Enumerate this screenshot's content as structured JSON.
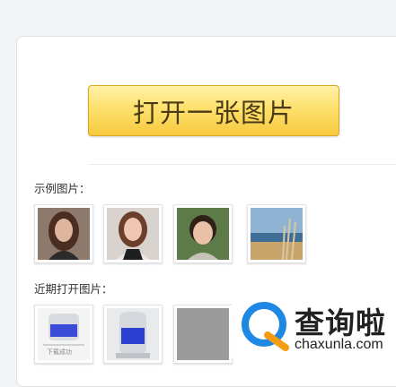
{
  "open_button": {
    "label": "打开一张图片"
  },
  "examples": {
    "label": "示例图片："
  },
  "recent": {
    "label": "近期打开图片：",
    "thumb_caption": "下载成功"
  },
  "watermark": {
    "title": "查询啦",
    "url": "chaxunla.com"
  },
  "colors": {
    "button_top": "#fff1a8",
    "button_bottom": "#f7c93f",
    "brand_blue": "#1e88e5",
    "brand_orange": "#f39c12"
  }
}
